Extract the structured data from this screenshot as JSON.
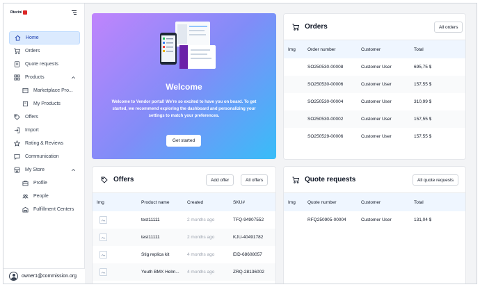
{
  "brand": {
    "logo_text": "Rtecini"
  },
  "sidebar": {
    "items": [
      {
        "label": "Home",
        "icon": "home-icon",
        "active": true
      },
      {
        "label": "Orders",
        "icon": "cart-icon"
      },
      {
        "label": "Quote requests",
        "icon": "quote-icon"
      },
      {
        "label": "Products",
        "icon": "grid-icon",
        "expanded": true
      },
      {
        "label": "Marketplace Pro...",
        "icon": "store-icon",
        "sub": true
      },
      {
        "label": "My Products",
        "icon": "box-icon",
        "sub": true
      },
      {
        "label": "Offers",
        "icon": "tag-icon"
      },
      {
        "label": "Import",
        "icon": "import-icon"
      },
      {
        "label": "Rating & Reviews",
        "icon": "star-icon"
      },
      {
        "label": "Communication",
        "icon": "chat-icon"
      },
      {
        "label": "My Store",
        "icon": "storefront-icon",
        "expanded": true
      },
      {
        "label": "Profile",
        "icon": "briefcase-icon",
        "sub": true
      },
      {
        "label": "People",
        "icon": "people-icon",
        "sub": true
      },
      {
        "label": "Fulfillment Centers",
        "icon": "warehouse-icon",
        "sub": true
      }
    ],
    "user_email": "owner1@commission.org"
  },
  "welcome": {
    "title": "Welcome",
    "text": "Welcome to Vendor portal! We're so excited to have you on board. To get started, we recommend exploring the dashboard and personalizing your settings to match your preferences.",
    "button": "Get started"
  },
  "orders": {
    "title": "Orders",
    "button": "All orders",
    "columns": [
      "Img",
      "Order number",
      "Customer",
      "Total"
    ],
    "rows": [
      {
        "number": "SO250530-00008",
        "customer": "Customer User",
        "total": "695,75 $"
      },
      {
        "number": "SO250530-00006",
        "customer": "Customer User",
        "total": "157,55 $"
      },
      {
        "number": "SO250530-00004",
        "customer": "Customer User",
        "total": "310,99 $"
      },
      {
        "number": "SO250530-00002",
        "customer": "Customer User",
        "total": "157,55 $"
      },
      {
        "number": "SO250529-00006",
        "customer": "Customer User",
        "total": "157,55 $"
      }
    ]
  },
  "offers": {
    "title": "Offers",
    "add_button": "Add offer",
    "all_button": "All offers",
    "columns": [
      "Img",
      "Product name",
      "Created",
      "SKU#"
    ],
    "rows": [
      {
        "name": "test11111",
        "created": "2 months ago",
        "sku": "TFQ-94907552"
      },
      {
        "name": "test11111",
        "created": "2 months ago",
        "sku": "KJU-40491782"
      },
      {
        "name": "Stig replica kit",
        "created": "4 months ago",
        "sku": "EID-68608057"
      },
      {
        "name": "Youth BMX Helm...",
        "created": "4 months ago",
        "sku": "ZRQ-28136002"
      }
    ]
  },
  "quotes": {
    "title": "Quote requests",
    "button": "All quote requests",
    "columns": [
      "Img",
      "Quote number",
      "Customer",
      "Total"
    ],
    "rows": [
      {
        "number": "RFQ250905-00004",
        "customer": "Customer User",
        "total": "131,04 $"
      }
    ]
  }
}
